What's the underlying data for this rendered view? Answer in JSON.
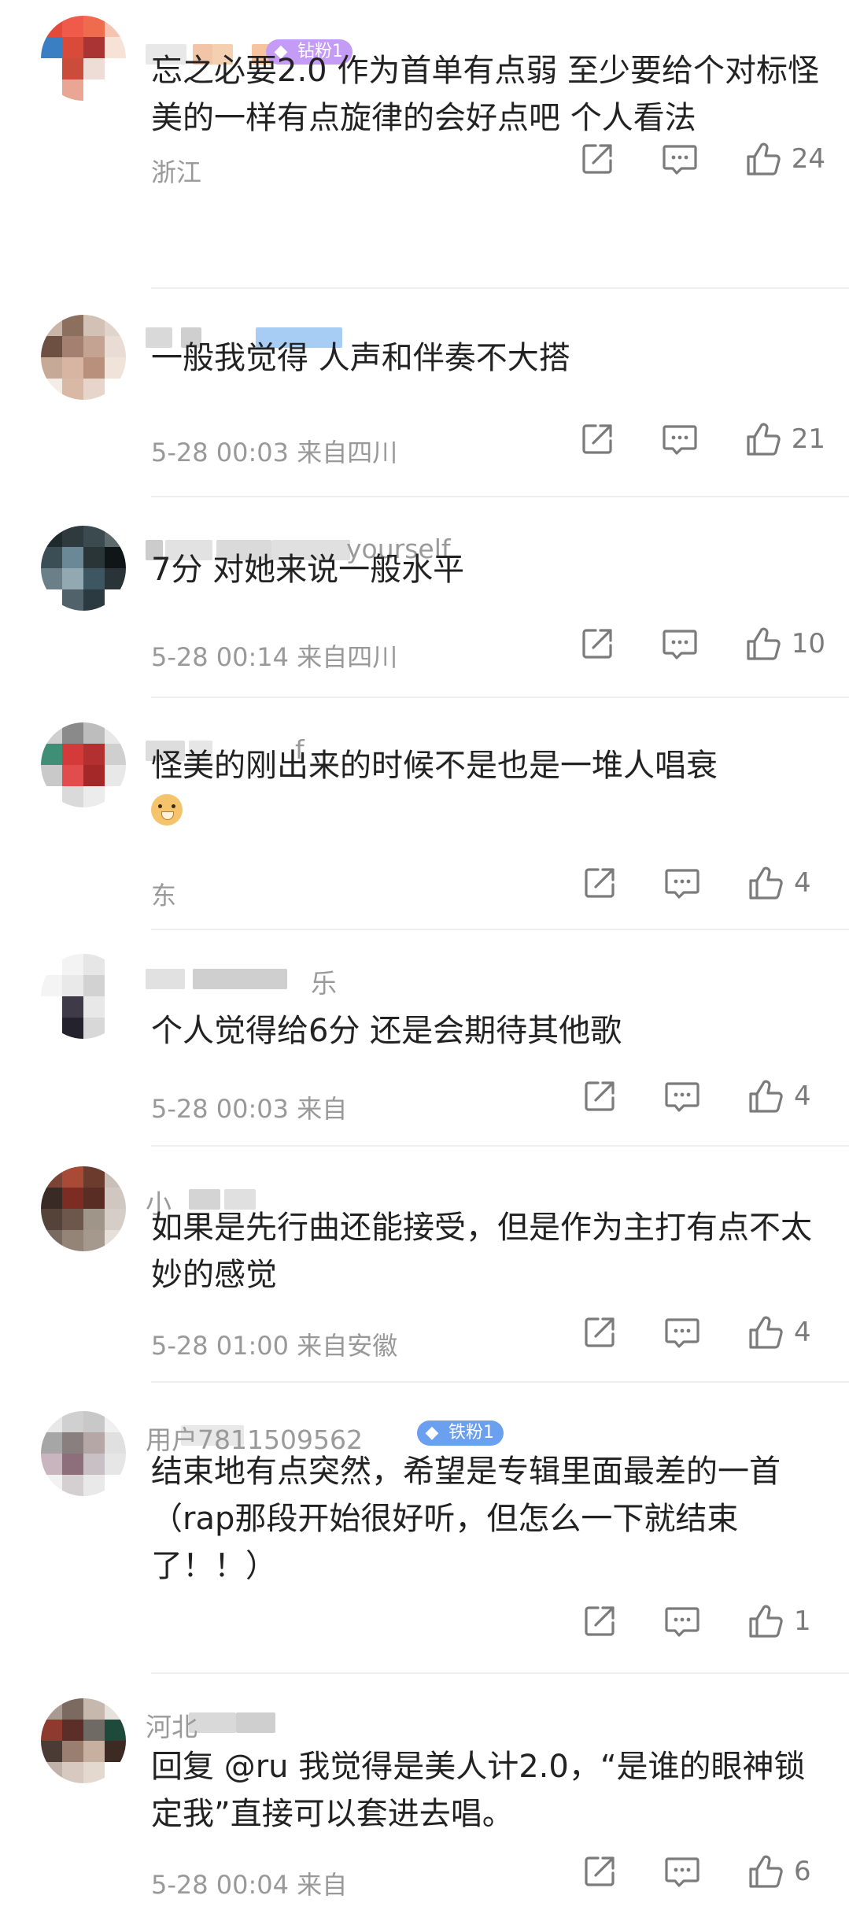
{
  "comments": [
    {
      "badge": {
        "text": "钻粉1",
        "color": "#c59cf5",
        "icon": "diamond-fan-icon"
      },
      "name_tail": "",
      "text": "忘之必要2.0 作为首单有点弱 至少要给个对标怪美的一样有点旋律的会好点吧 个人看法",
      "meta": "浙江",
      "likes": "24",
      "emoji": false
    },
    {
      "name_tail": "",
      "text": "一般我觉得 人声和伴奏不大搭",
      "meta": "5-28 00:03 来自四川",
      "likes": "21",
      "emoji": false
    },
    {
      "name_tail": "yourself",
      "text": "7分 对她来说一般水平",
      "meta": "5-28 00:14 来自四川",
      "likes": "10",
      "emoji": false
    },
    {
      "name_tail": "f",
      "text": "怪美的刚出来的时候不是也是一堆人唱衰",
      "meta": "东",
      "likes": "4",
      "emoji": true
    },
    {
      "name_tail": "乐",
      "text": "个人觉得给6分 还是会期待其他歌",
      "meta": "5-28 00:03 来自",
      "likes": "4",
      "emoji": false
    },
    {
      "name_tail": "小",
      "text": "如果是先行曲还能接受，但是作为主打有点不太妙的感觉",
      "meta": "5-28 01:00 来自安徽",
      "likes": "4",
      "emoji": false
    },
    {
      "badge": {
        "text": "铁粉1",
        "color": "#6b9ff0",
        "icon": "iron-fan-icon"
      },
      "name_tail": "用户7811509562",
      "text": "结束地有点突然，希望是专辑里面最差的一首（rap那段开始很好听，但怎么一下就结束了！！）",
      "meta": "",
      "likes": "1",
      "emoji": false
    },
    {
      "name_tail": "河北",
      "text": "回复 @ru 我觉得是美人计2.0，“是谁的眼神锁定我”直接可以套进去唱。",
      "meta": "5-28 00:04 来自",
      "likes": "6",
      "emoji": false
    }
  ],
  "icons": {
    "share": "share-icon",
    "reply": "reply-icon",
    "like": "like-icon"
  },
  "colors": {
    "icon": "#7b7b7b",
    "meta": "#999999",
    "divider": "#eeeeee"
  }
}
